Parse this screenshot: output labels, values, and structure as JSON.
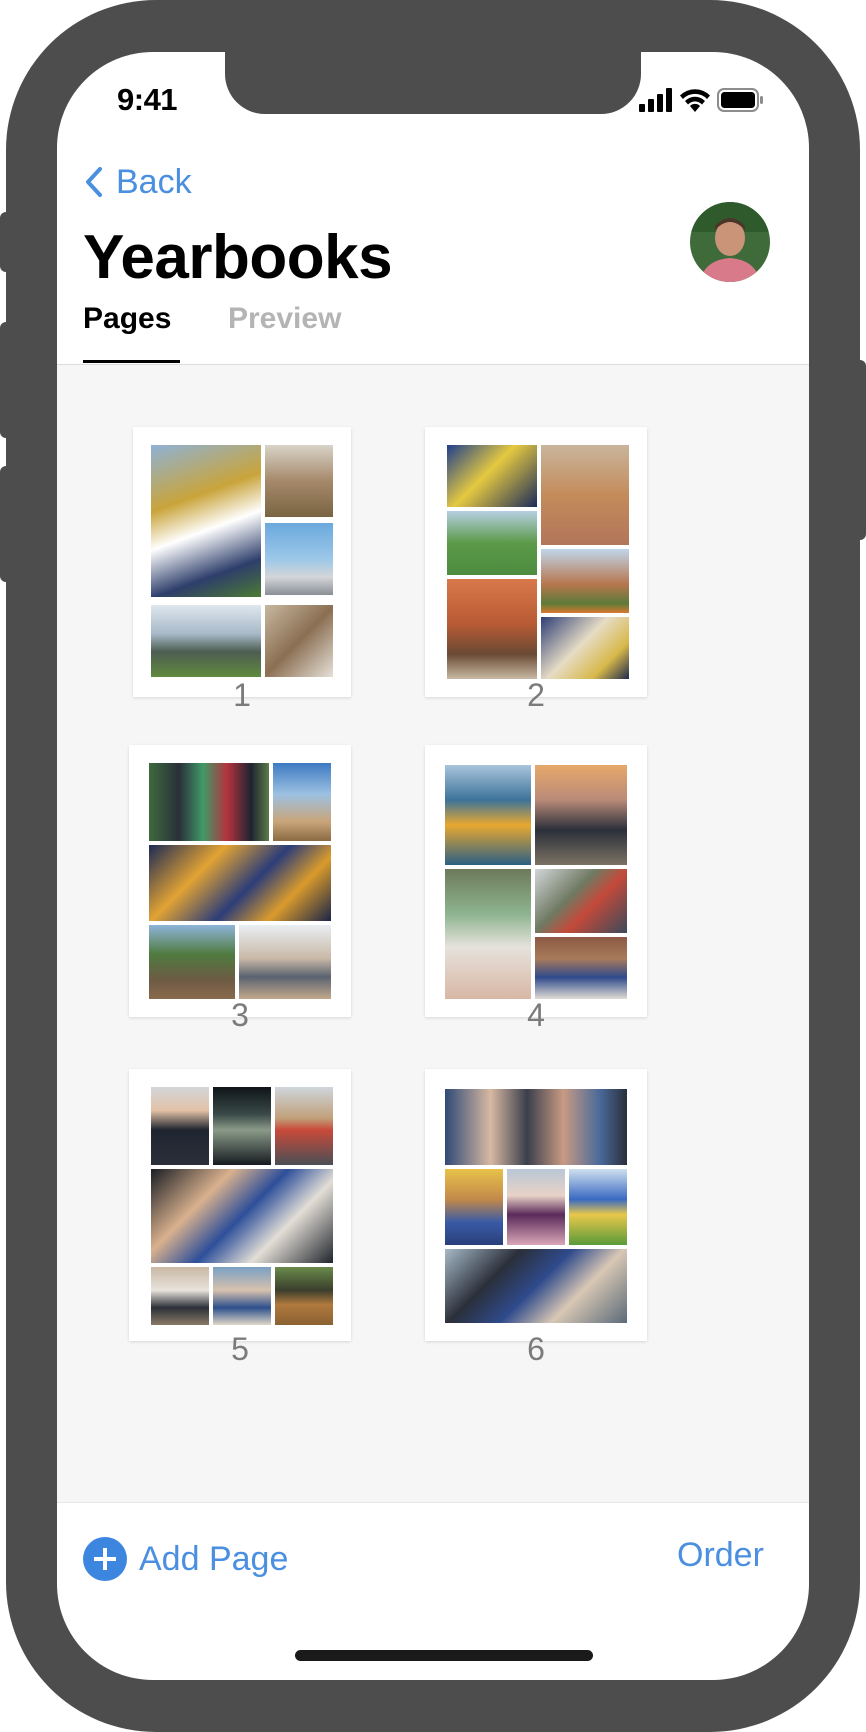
{
  "status_bar": {
    "time": "9:41",
    "icons": [
      "signal-icon",
      "wifi-icon",
      "battery-icon"
    ]
  },
  "nav": {
    "back_label": "Back",
    "back_icon": "chevron-left-icon",
    "title": "Yearbooks",
    "avatar_icon": "user-avatar"
  },
  "tabs": [
    {
      "label": "Pages",
      "active": true
    },
    {
      "label": "Preview",
      "active": false
    }
  ],
  "pages": [
    {
      "number": "1"
    },
    {
      "number": "2"
    },
    {
      "number": "3"
    },
    {
      "number": "4"
    },
    {
      "number": "5"
    },
    {
      "number": "6"
    }
  ],
  "footer": {
    "add_label": "Add Page",
    "add_icon": "plus-circle-icon",
    "order_label": "Order"
  },
  "colors": {
    "accent": "#4a8fe0",
    "frame": "#4d4d4d",
    "grid_background": "#f6f6f6",
    "inactive_tab": "#b4b4b4",
    "page_number": "#7b7b7b"
  }
}
